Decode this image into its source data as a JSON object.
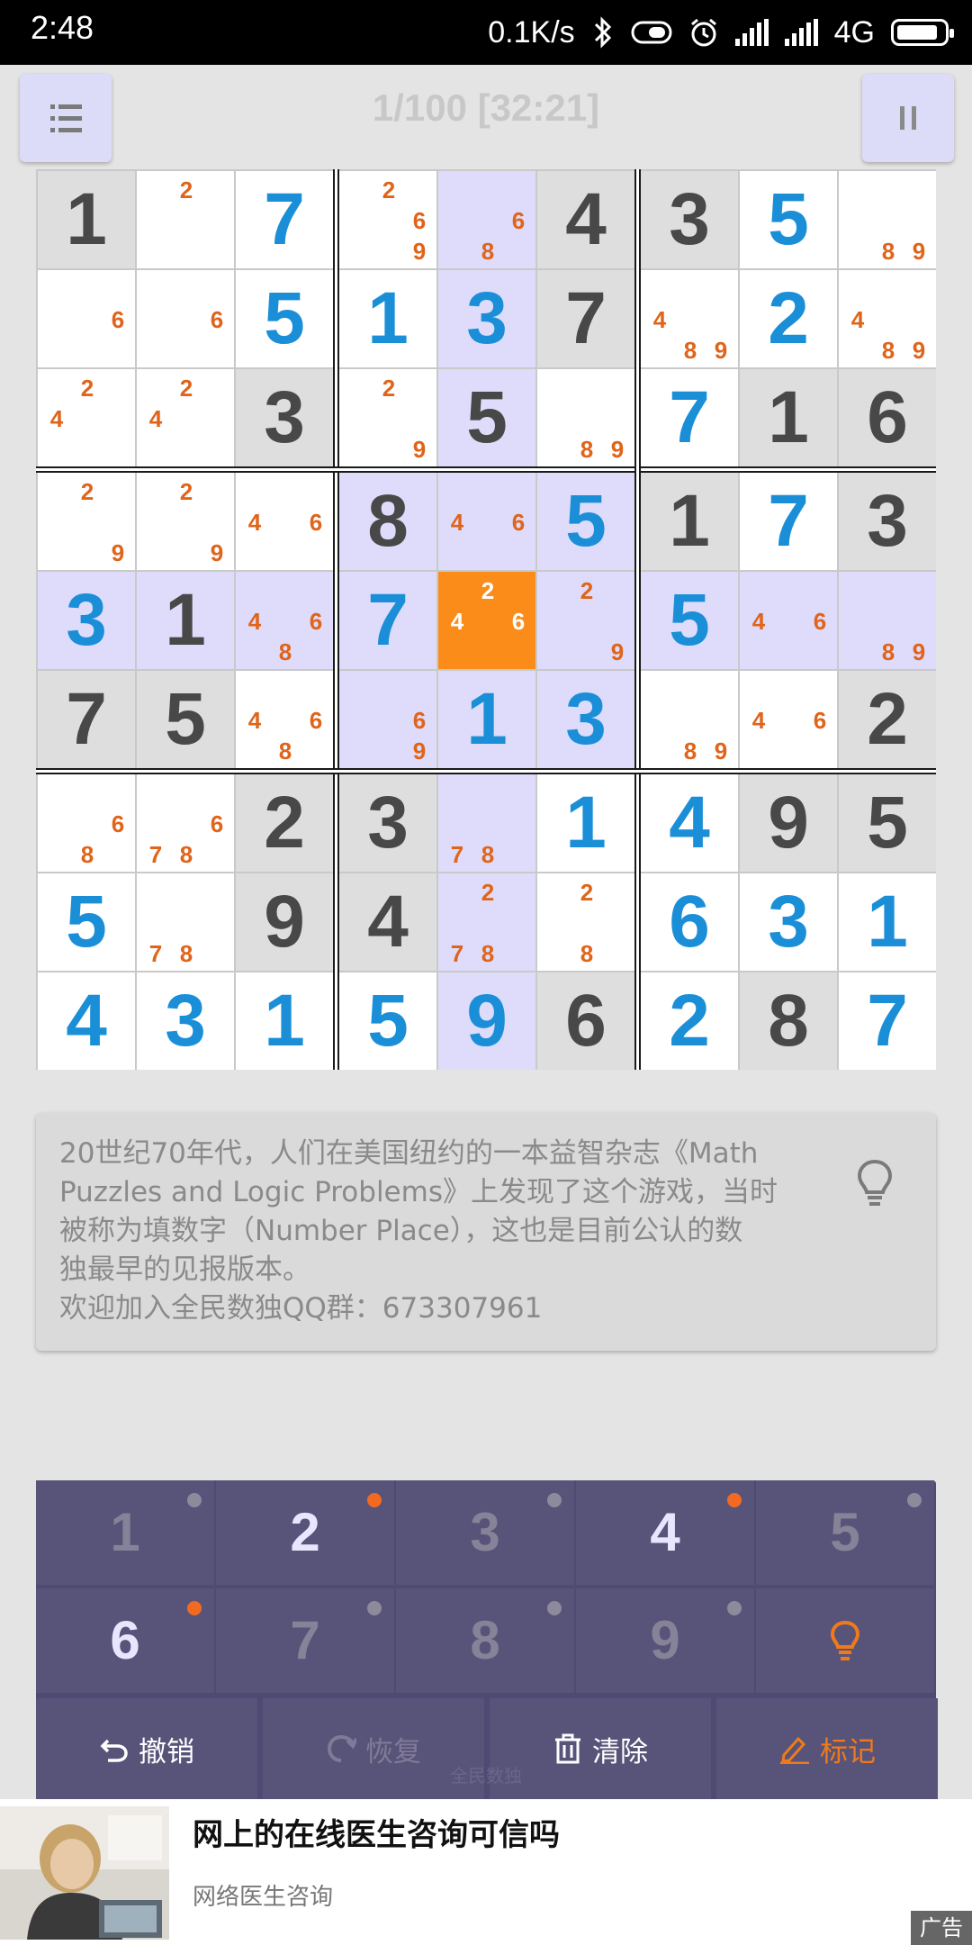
{
  "status_bar": {
    "time": "2:48",
    "net_speed": "0.1K/s",
    "network": "4G",
    "icons": [
      "bluetooth-icon",
      "sim-icon",
      "alarm-icon",
      "signal-icon",
      "signal-icon",
      "battery-icon"
    ]
  },
  "header": {
    "title": "1/100 [32:21]",
    "menu_icon": "list-icon",
    "pause_icon": "pause-icon"
  },
  "board": {
    "selected_cell": [
      4,
      4
    ],
    "highlight_cells": [
      [
        0,
        4
      ],
      [
        1,
        4
      ],
      [
        2,
        4
      ],
      [
        3,
        3
      ],
      [
        3,
        4
      ],
      [
        3,
        5
      ],
      [
        4,
        0
      ],
      [
        4,
        1
      ],
      [
        4,
        2
      ],
      [
        4,
        3
      ],
      [
        4,
        5
      ],
      [
        4,
        6
      ],
      [
        4,
        7
      ],
      [
        4,
        8
      ],
      [
        5,
        3
      ],
      [
        5,
        4
      ],
      [
        5,
        5
      ],
      [
        6,
        4
      ],
      [
        7,
        4
      ],
      [
        8,
        4
      ]
    ],
    "given_bg_cells": [
      [
        0,
        0
      ],
      [
        0,
        5
      ],
      [
        0,
        6
      ],
      [
        1,
        5
      ],
      [
        2,
        2
      ],
      [
        2,
        4
      ],
      [
        2,
        7
      ],
      [
        2,
        8
      ],
      [
        3,
        6
      ],
      [
        3,
        8
      ],
      [
        5,
        0
      ],
      [
        5,
        1
      ],
      [
        5,
        8
      ],
      [
        6,
        2
      ],
      [
        6,
        3
      ],
      [
        6,
        7
      ],
      [
        6,
        8
      ],
      [
        7,
        2
      ],
      [
        7,
        3
      ],
      [
        8,
        5
      ],
      [
        8,
        7
      ]
    ],
    "cells": [
      [
        {
          "v": "1",
          "t": "given"
        },
        {
          "n": [
            2
          ]
        },
        {
          "v": "7",
          "t": "user"
        },
        {
          "n": [
            2,
            6,
            9
          ]
        },
        {
          "n": [
            6,
            8
          ]
        },
        {
          "v": "4",
          "t": "given"
        },
        {
          "v": "3",
          "t": "given"
        },
        {
          "v": "5",
          "t": "user"
        },
        {
          "n": [
            8,
            9
          ]
        }
      ],
      [
        {
          "n": [
            6
          ]
        },
        {
          "n": [
            6
          ]
        },
        {
          "v": "5",
          "t": "user"
        },
        {
          "v": "1",
          "t": "user"
        },
        {
          "v": "3",
          "t": "user"
        },
        {
          "v": "7",
          "t": "given"
        },
        {
          "n": [
            4,
            8,
            9
          ]
        },
        {
          "v": "2",
          "t": "user"
        },
        {
          "n": [
            4,
            8,
            9
          ]
        }
      ],
      [
        {
          "n": [
            2,
            4
          ]
        },
        {
          "n": [
            2,
            4
          ]
        },
        {
          "v": "3",
          "t": "given"
        },
        {
          "n": [
            2,
            9
          ]
        },
        {
          "v": "5",
          "t": "given"
        },
        {
          "n": [
            8,
            9
          ]
        },
        {
          "v": "7",
          "t": "user"
        },
        {
          "v": "1",
          "t": "given"
        },
        {
          "v": "6",
          "t": "given"
        }
      ],
      [
        {
          "n": [
            2,
            9
          ]
        },
        {
          "n": [
            2,
            9
          ]
        },
        {
          "n": [
            4,
            6
          ]
        },
        {
          "v": "8",
          "t": "given"
        },
        {
          "n": [
            4,
            6
          ]
        },
        {
          "v": "5",
          "t": "user"
        },
        {
          "v": "1",
          "t": "given"
        },
        {
          "v": "7",
          "t": "user"
        },
        {
          "v": "3",
          "t": "given"
        }
      ],
      [
        {
          "v": "3",
          "t": "user"
        },
        {
          "v": "1",
          "t": "given"
        },
        {
          "n": [
            4,
            6,
            8
          ]
        },
        {
          "v": "7",
          "t": "user"
        },
        {
          "n": [
            2,
            4,
            6
          ]
        },
        {
          "n": [
            2,
            9
          ]
        },
        {
          "v": "5",
          "t": "user"
        },
        {
          "n": [
            4,
            6
          ]
        },
        {
          "n": [
            8,
            9
          ]
        }
      ],
      [
        {
          "v": "7",
          "t": "given"
        },
        {
          "v": "5",
          "t": "given"
        },
        {
          "n": [
            4,
            6,
            8
          ]
        },
        {
          "n": [
            6,
            9
          ]
        },
        {
          "v": "1",
          "t": "user"
        },
        {
          "v": "3",
          "t": "user"
        },
        {
          "n": [
            8,
            9
          ]
        },
        {
          "n": [
            4,
            6
          ]
        },
        {
          "v": "2",
          "t": "given"
        }
      ],
      [
        {
          "n": [
            6,
            8
          ]
        },
        {
          "n": [
            6,
            7,
            8
          ]
        },
        {
          "v": "2",
          "t": "given"
        },
        {
          "v": "3",
          "t": "given"
        },
        {
          "n": [
            7,
            8
          ]
        },
        {
          "v": "1",
          "t": "user"
        },
        {
          "v": "4",
          "t": "user"
        },
        {
          "v": "9",
          "t": "given"
        },
        {
          "v": "5",
          "t": "given"
        }
      ],
      [
        {
          "v": "5",
          "t": "user"
        },
        {
          "n": [
            7,
            8
          ]
        },
        {
          "v": "9",
          "t": "given"
        },
        {
          "v": "4",
          "t": "given"
        },
        {
          "n": [
            2,
            7,
            8
          ]
        },
        {
          "n": [
            2,
            8
          ]
        },
        {
          "v": "6",
          "t": "user"
        },
        {
          "v": "3",
          "t": "user"
        },
        {
          "v": "1",
          "t": "user"
        }
      ],
      [
        {
          "v": "4",
          "t": "user"
        },
        {
          "v": "3",
          "t": "user"
        },
        {
          "v": "1",
          "t": "user"
        },
        {
          "v": "5",
          "t": "user"
        },
        {
          "v": "9",
          "t": "user"
        },
        {
          "v": "6",
          "t": "given"
        },
        {
          "v": "2",
          "t": "user"
        },
        {
          "v": "8",
          "t": "given"
        },
        {
          "v": "7",
          "t": "user"
        }
      ]
    ]
  },
  "tip": {
    "lines": [
      "20世纪70年代，人们在美国纽约的一本益智杂志《Math",
      "Puzzles and Logic Problems》上发现了这个游戏，当时",
      "被称为填数字（Number Place），这也是目前公认的数",
      "独最早的见报版本。",
      "欢迎加入全民数独QQ群：673307961"
    ],
    "icon": "lightbulb-icon"
  },
  "keypad": {
    "keys": [
      {
        "label": "1",
        "enabled": false
      },
      {
        "label": "2",
        "enabled": true
      },
      {
        "label": "3",
        "enabled": false
      },
      {
        "label": "4",
        "enabled": true
      },
      {
        "label": "5",
        "enabled": false
      },
      {
        "label": "6",
        "enabled": true
      },
      {
        "label": "7",
        "enabled": false
      },
      {
        "label": "8",
        "enabled": false
      },
      {
        "label": "9",
        "enabled": false
      },
      {
        "label": "",
        "enabled": true,
        "icon": "lightbulb-icon"
      }
    ],
    "actions": {
      "undo": "撤销",
      "redo": "恢复",
      "clear": "清除",
      "mark": "标记"
    },
    "watermark": "全民数独"
  },
  "ad": {
    "title": "网上的在线医生咨询可信吗",
    "subtitle": "网络医生咨询",
    "badge": "广告"
  },
  "colors": {
    "accent_orange": "#f07a1a",
    "selected_cell": "#fb8c1a",
    "highlight": "#dedcfa",
    "given_bg": "#dedede",
    "user_digit": "#1a8fd8",
    "given_digit": "#484848",
    "note": "#e0641a",
    "keypad_bg": "#585379"
  }
}
